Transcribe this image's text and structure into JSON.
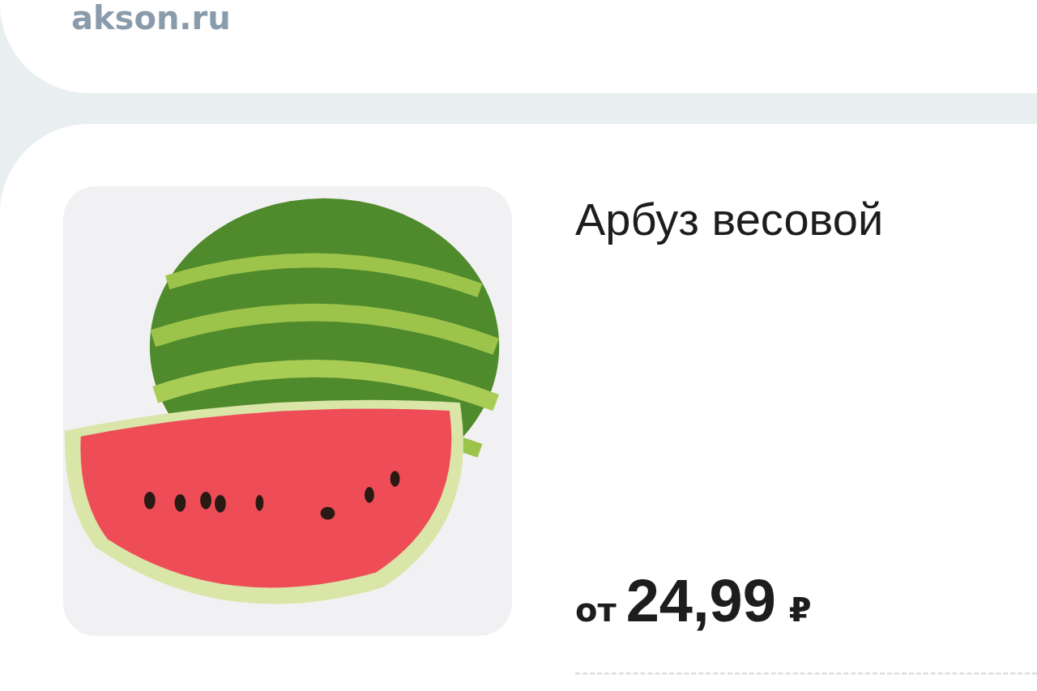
{
  "header": {
    "site": "akson.ru"
  },
  "product": {
    "title": "Арбуз весовой",
    "price_prefix": "от",
    "price": "24,99",
    "currency": "₽"
  }
}
